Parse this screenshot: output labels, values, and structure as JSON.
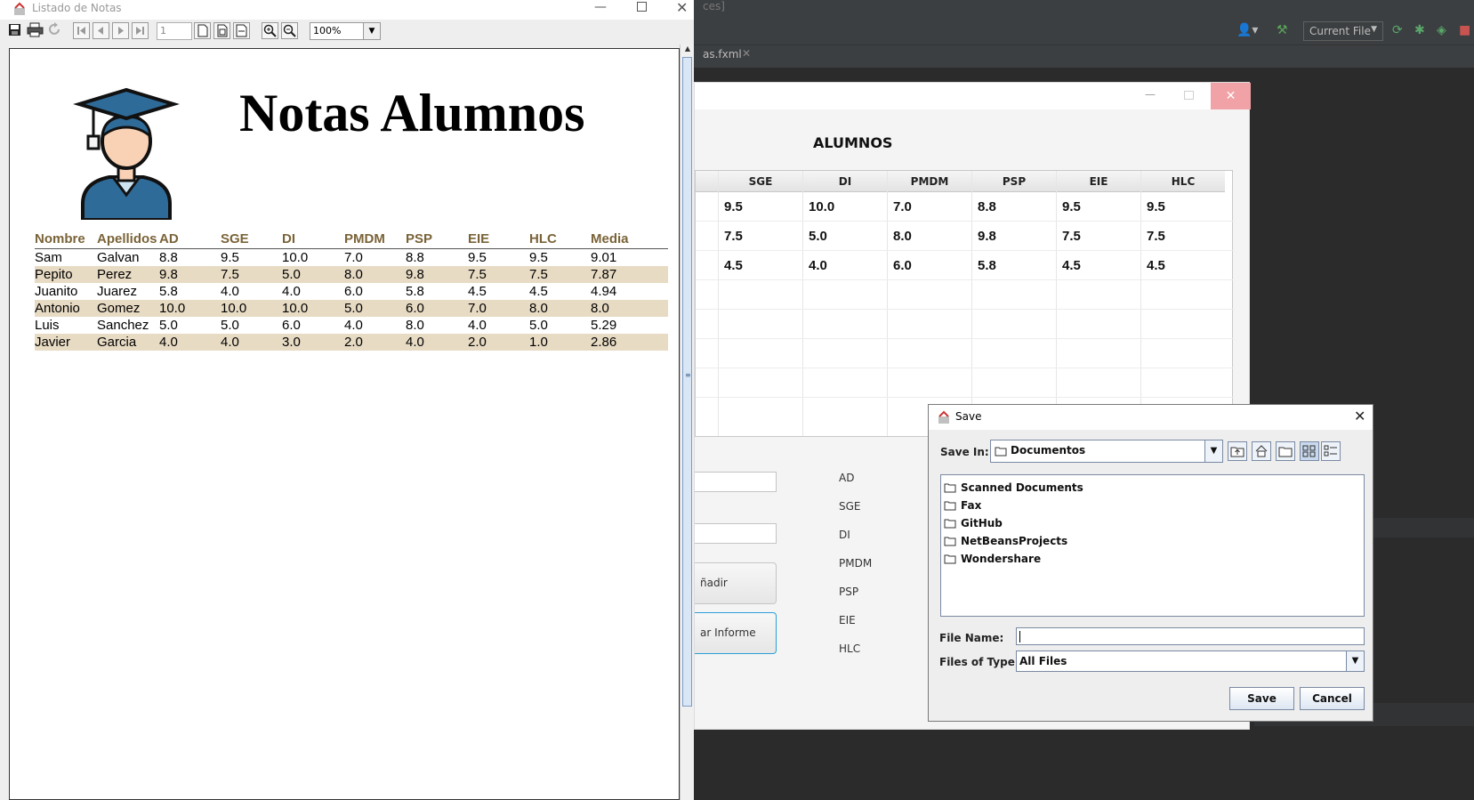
{
  "ide": {
    "tab_label": "as.fxml",
    "title_fragment": "ces]",
    "run_config": "Current File"
  },
  "app": {
    "heading": "ALUMNOS",
    "columns": [
      "SGE",
      "DI",
      "PMDM",
      "PSP",
      "EIE",
      "HLC"
    ],
    "rows": [
      [
        "9.5",
        "10.0",
        "7.0",
        "8.8",
        "9.5",
        "9.5"
      ],
      [
        "7.5",
        "5.0",
        "8.0",
        "9.8",
        "7.5",
        "7.5"
      ],
      [
        "4.5",
        "4.0",
        "6.0",
        "5.8",
        "4.5",
        "4.5"
      ]
    ],
    "form_labels": [
      "AD",
      "SGE",
      "DI",
      "PMDM",
      "PSP",
      "EIE",
      "HLC"
    ],
    "add_button": "ñadir",
    "report_button": "ar Informe"
  },
  "viewer": {
    "window_title": "Listado de Notas",
    "page_number": "1",
    "zoom": "100%",
    "report_title": "Notas Alumnos",
    "headers": [
      "Nombre",
      "Apellidos",
      "AD",
      "SGE",
      "DI",
      "PMDM",
      "PSP",
      "EIE",
      "HLC",
      "Media"
    ],
    "rows": [
      [
        "Sam",
        "Galvan",
        "8.8",
        "9.5",
        "10.0",
        "7.0",
        "8.8",
        "9.5",
        "9.5",
        "9.01"
      ],
      [
        "Pepito",
        "Perez",
        "9.8",
        "7.5",
        "5.0",
        "8.0",
        "9.8",
        "7.5",
        "7.5",
        "7.87"
      ],
      [
        "Juanito",
        "Juarez",
        "5.8",
        "4.0",
        "4.0",
        "6.0",
        "5.8",
        "4.5",
        "4.5",
        "4.94"
      ],
      [
        "Antonio",
        "Gomez",
        "10.0",
        "10.0",
        "10.0",
        "5.0",
        "6.0",
        "7.0",
        "8.0",
        "8.0"
      ],
      [
        "Luis",
        "Sanchez",
        "5.0",
        "5.0",
        "6.0",
        "4.0",
        "8.0",
        "4.0",
        "5.0",
        "5.29"
      ],
      [
        "Javier",
        "Garcia",
        "4.0",
        "4.0",
        "3.0",
        "2.0",
        "4.0",
        "2.0",
        "1.0",
        "2.86"
      ]
    ],
    "colors": {
      "header_text": "#7a6338",
      "alt_row": "#e8dbc4"
    }
  },
  "dialog": {
    "title": "Save",
    "save_in_label": "Save In:",
    "save_in_value": "Documentos",
    "folders": [
      "Scanned Documents",
      "Fax",
      "GitHub",
      "NetBeansProjects",
      "Wondershare"
    ],
    "file_name_label": "File Name:",
    "file_name_value": "",
    "file_type_label": "Files of Type:",
    "file_type_value": "All Files",
    "save_button": "Save",
    "cancel_button": "Cancel"
  }
}
